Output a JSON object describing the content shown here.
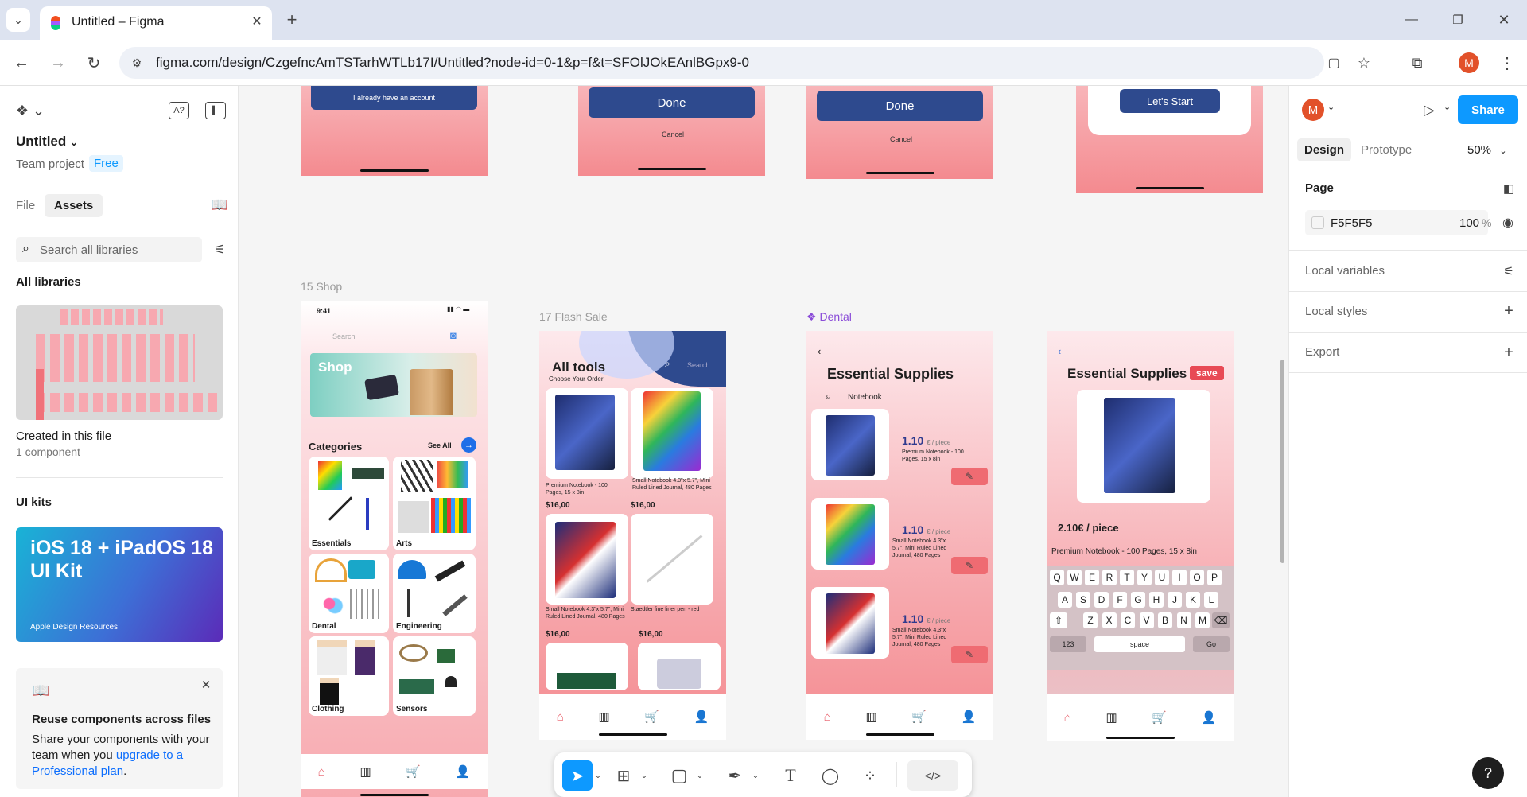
{
  "browser": {
    "tab_title": "Untitled – Figma",
    "url": "figma.com/design/CzgefncAmTSTarhWTLb17I/Untitled?node-id=0-1&p=f&t=SFOlJOkEAnlBGpx9-0",
    "profile_initial": "M"
  },
  "left_panel": {
    "file_name": "Untitled",
    "team": "Team project",
    "plan_badge": "Free",
    "tab_file": "File",
    "tab_assets": "Assets",
    "search_placeholder": "Search all libraries",
    "all_libraries": "All libraries",
    "created_title": "Created in this file",
    "created_count": "1 component",
    "ui_kits": "UI kits",
    "kit_title": "iOS 18 + iPadOS 18 UI Kit",
    "kit_sub": "Apple Design Resources",
    "promo_title": "Reuse components across files",
    "promo_body": "Share your components with your team when you ",
    "promo_link": "upgrade to a Professional plan",
    "promo_end": "."
  },
  "canvas": {
    "top_frames": {
      "already": "I already have an account",
      "done1": "Done",
      "cancel1": "Cancel",
      "done2": "Done",
      "cancel2": "Cancel",
      "start": "Let's Start"
    },
    "shop": {
      "label": "15 Shop",
      "time": "9:41",
      "search": "Search",
      "banner": "Shop",
      "categories": "Categories",
      "see_all": "See All",
      "cats": [
        "Essentials",
        "Arts",
        "Dental",
        "Engineering",
        "Clothing",
        "Sensors"
      ]
    },
    "flash": {
      "label": "17 Flash Sale",
      "title": "All tools",
      "subtitle": "Choose Your Order",
      "search": "Search",
      "items": [
        {
          "name": "Premium Notebook - 100 Pages, 15 x 8in",
          "price": "$16,00"
        },
        {
          "name": "Small Notebook 4.3\"x 5.7\", Mini Ruled Lined Journal, 480 Pages",
          "price": "$16,00"
        },
        {
          "name": "Small Notebook 4.3\"x 5.7\", Mini Ruled Lined Journal, 480 Pages",
          "price": "$16,00"
        },
        {
          "name": "Staedtler fine liner pen - red",
          "price": "$16,00"
        }
      ]
    },
    "dental": {
      "label": "Dental",
      "title": "Essential Supplies",
      "search": "Notebook",
      "items": [
        {
          "price": "1.10",
          "unit": "€ / piece",
          "name": "Premium Notebook - 100 Pages, 15 x 8in"
        },
        {
          "price": "1.10",
          "unit": "€ / piece",
          "name": "Small Notebook 4.3\"x 5.7\", Mini Ruled Lined Journal, 480 Pages"
        },
        {
          "price": "1.10",
          "unit": "€ / piece",
          "name": "Small Notebook 4.3\"x 5.7\", Mini Ruled Lined Journal, 480 Pages"
        }
      ]
    },
    "detail": {
      "title": "Essential Supplies",
      "save": "save",
      "price": "2.10€ / piece",
      "name": "Premium Notebook - 100 Pages, 15 x 8in",
      "row1": [
        "Q",
        "W",
        "E",
        "R",
        "T",
        "Y",
        "U",
        "I",
        "O",
        "P"
      ],
      "row2": [
        "A",
        "S",
        "D",
        "F",
        "G",
        "H",
        "J",
        "K",
        "L"
      ],
      "row3": [
        "Z",
        "X",
        "C",
        "V",
        "B",
        "N",
        "M"
      ],
      "k123": "123",
      "space": "space",
      "go": "Go"
    }
  },
  "right_panel": {
    "design": "Design",
    "prototype": "Prototype",
    "zoom": "50%",
    "share": "Share",
    "page": "Page",
    "page_color": "F5F5F5",
    "opacity": "100",
    "pct": "%",
    "local_variables": "Local variables",
    "local_styles": "Local styles",
    "export": "Export",
    "avatar": "M"
  },
  "toolbar": {
    "help": "?"
  }
}
